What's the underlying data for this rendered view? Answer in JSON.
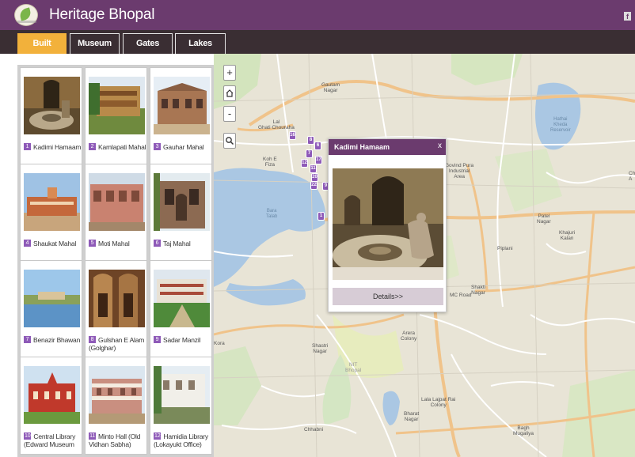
{
  "app": {
    "title": "Heritage Bhopal",
    "social_icon": "facebook-icon",
    "social_glyph": "f"
  },
  "tabs": [
    {
      "label": "Built Heritage",
      "active": true
    },
    {
      "label": "Museum",
      "active": false
    },
    {
      "label": "Gates",
      "active": false
    },
    {
      "label": "Lakes",
      "active": false
    }
  ],
  "cards": [
    {
      "num": "1",
      "name": "Kadimi Hamaam"
    },
    {
      "num": "2",
      "name": "Kamlapati Mahal"
    },
    {
      "num": "3",
      "name": "Gauhar Mahal"
    },
    {
      "num": "4",
      "name": "Shaukat Mahal"
    },
    {
      "num": "5",
      "name": "Moti Mahal"
    },
    {
      "num": "6",
      "name": "Taj Mahal"
    },
    {
      "num": "7",
      "name": "Benazir Bhawan"
    },
    {
      "num": "8",
      "name": "Gulshan E Alam (Golghar)"
    },
    {
      "num": "9",
      "name": "Sadar Manzil"
    },
    {
      "num": "10",
      "name": "Central Library (Edward Museum"
    },
    {
      "num": "11",
      "name": "Minto Hall (Old Vidhan Sabha)"
    },
    {
      "num": "12",
      "name": "Hamidia Library (Lokayukt Office)"
    }
  ],
  "map_controls": {
    "zoom_in": "+",
    "home_icon": "home-icon",
    "zoom_out": "-",
    "search_icon": "search-icon"
  },
  "popup": {
    "title": "Kadimi Hamaam",
    "close": "x",
    "details": "Details>>"
  },
  "markers": [
    "16",
    "8",
    "6",
    "7",
    "12",
    "11",
    "17",
    "20",
    "22",
    "9",
    "1"
  ],
  "map_labels": {
    "gautam_nagar": "Gautam\nNagar",
    "lal_ghati": "Lal\nGhati Chouraha",
    "koh_e_fiza": "Koh E\nFiza",
    "bara_talab": "Bara\nTalab",
    "govind_pura": "Govind Pura\nIndustrial\nArea",
    "patel_nagar": "Patel\nNagar",
    "khajuri_kalan": "Khajuri\nKalan",
    "piplani": "Piplani",
    "shakti_nagar": "Shakti\nNagar",
    "mc_road": "MC Road",
    "arera_colony": "Arera\nColony",
    "shastri_nagar": "Shastri\nNagar",
    "nit_bhopal": "NIT\nBhopal",
    "lala_lajpat": "Lala Lajpat Rai\nColony",
    "bharat_nagar": "Bharat\nNagar",
    "chhabni": "Chhabni",
    "bagh_mugaliya": "Bagh\nMugaliya",
    "kora": "Kora",
    "hathai_kheda": "Hathai\nKheda\nReservoir",
    "ch_a": "Ch\nA"
  },
  "colors": {
    "header": "#6b3b6e",
    "tabbar": "#3a2e33",
    "active_tab": "#f2b13b",
    "marker": "#8e5ab8",
    "water": "#aac7e3",
    "map_bg": "#e9e6da"
  }
}
